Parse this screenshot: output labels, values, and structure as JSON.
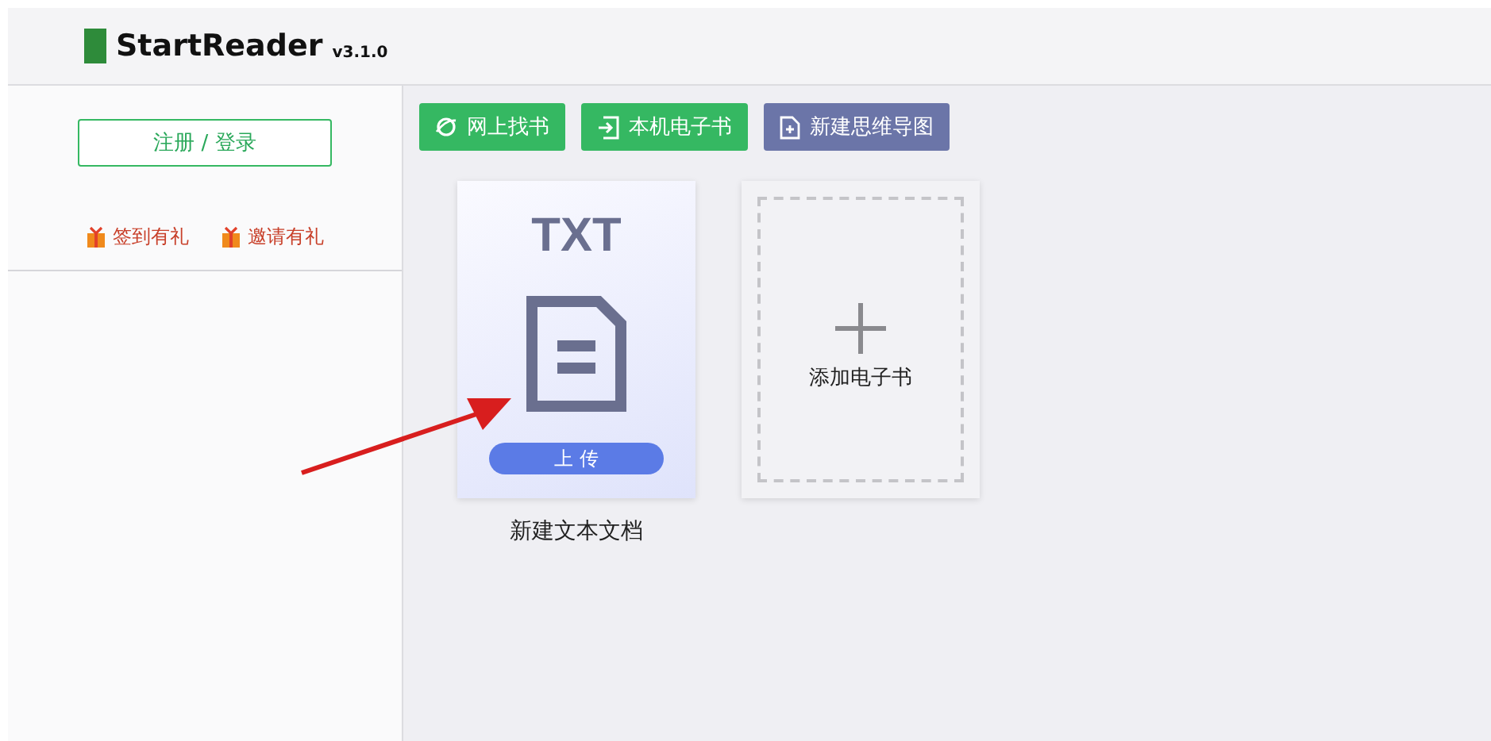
{
  "app": {
    "name": "StartReader",
    "version": "v3.1.0"
  },
  "sidebar": {
    "login_button": "注册 / 登录",
    "rewards": [
      {
        "label": "签到有礼"
      },
      {
        "label": "邀请有礼"
      }
    ]
  },
  "toolbar": [
    {
      "label": "网上找书",
      "kind": "online"
    },
    {
      "label": "本机电子书",
      "kind": "local"
    },
    {
      "label": "新建思维导图",
      "kind": "mindmap"
    }
  ],
  "books": [
    {
      "format": "TXT",
      "upload": "上 传",
      "title": "新建文本文档"
    }
  ],
  "add_card": {
    "label": "添加电子书"
  }
}
